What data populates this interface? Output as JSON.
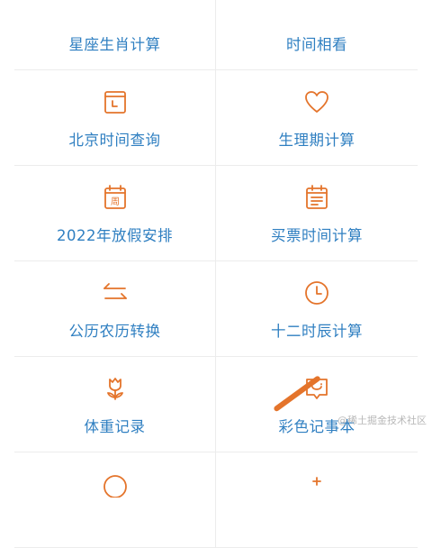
{
  "accent": "#e4742b",
  "label_color": "#2f7fc1",
  "tools": [
    {
      "label": "星座生肖计算",
      "icon": "partial-icon"
    },
    {
      "label": "时间相看",
      "icon": "partial-icon"
    },
    {
      "label": "北京时间查询",
      "icon": "clock-square-icon"
    },
    {
      "label": "生理期计算",
      "icon": "heart-icon"
    },
    {
      "label": "2022年放假安排",
      "icon": "calendar-week-icon",
      "icon_text": "周"
    },
    {
      "label": "买票时间计算",
      "icon": "calendar-list-icon"
    },
    {
      "label": "公历农历转换",
      "icon": "swap-arrows-icon"
    },
    {
      "label": "十二时辰计算",
      "icon": "clock-icon"
    },
    {
      "label": "体重记录",
      "icon": "flower-icon"
    },
    {
      "label": "彩色记事本",
      "icon": "smile-chat-icon"
    },
    {
      "label": "",
      "icon": "partial-icon"
    },
    {
      "label": "",
      "icon": "partial-icon"
    }
  ],
  "watermark": "@稀土掘金技术社区"
}
